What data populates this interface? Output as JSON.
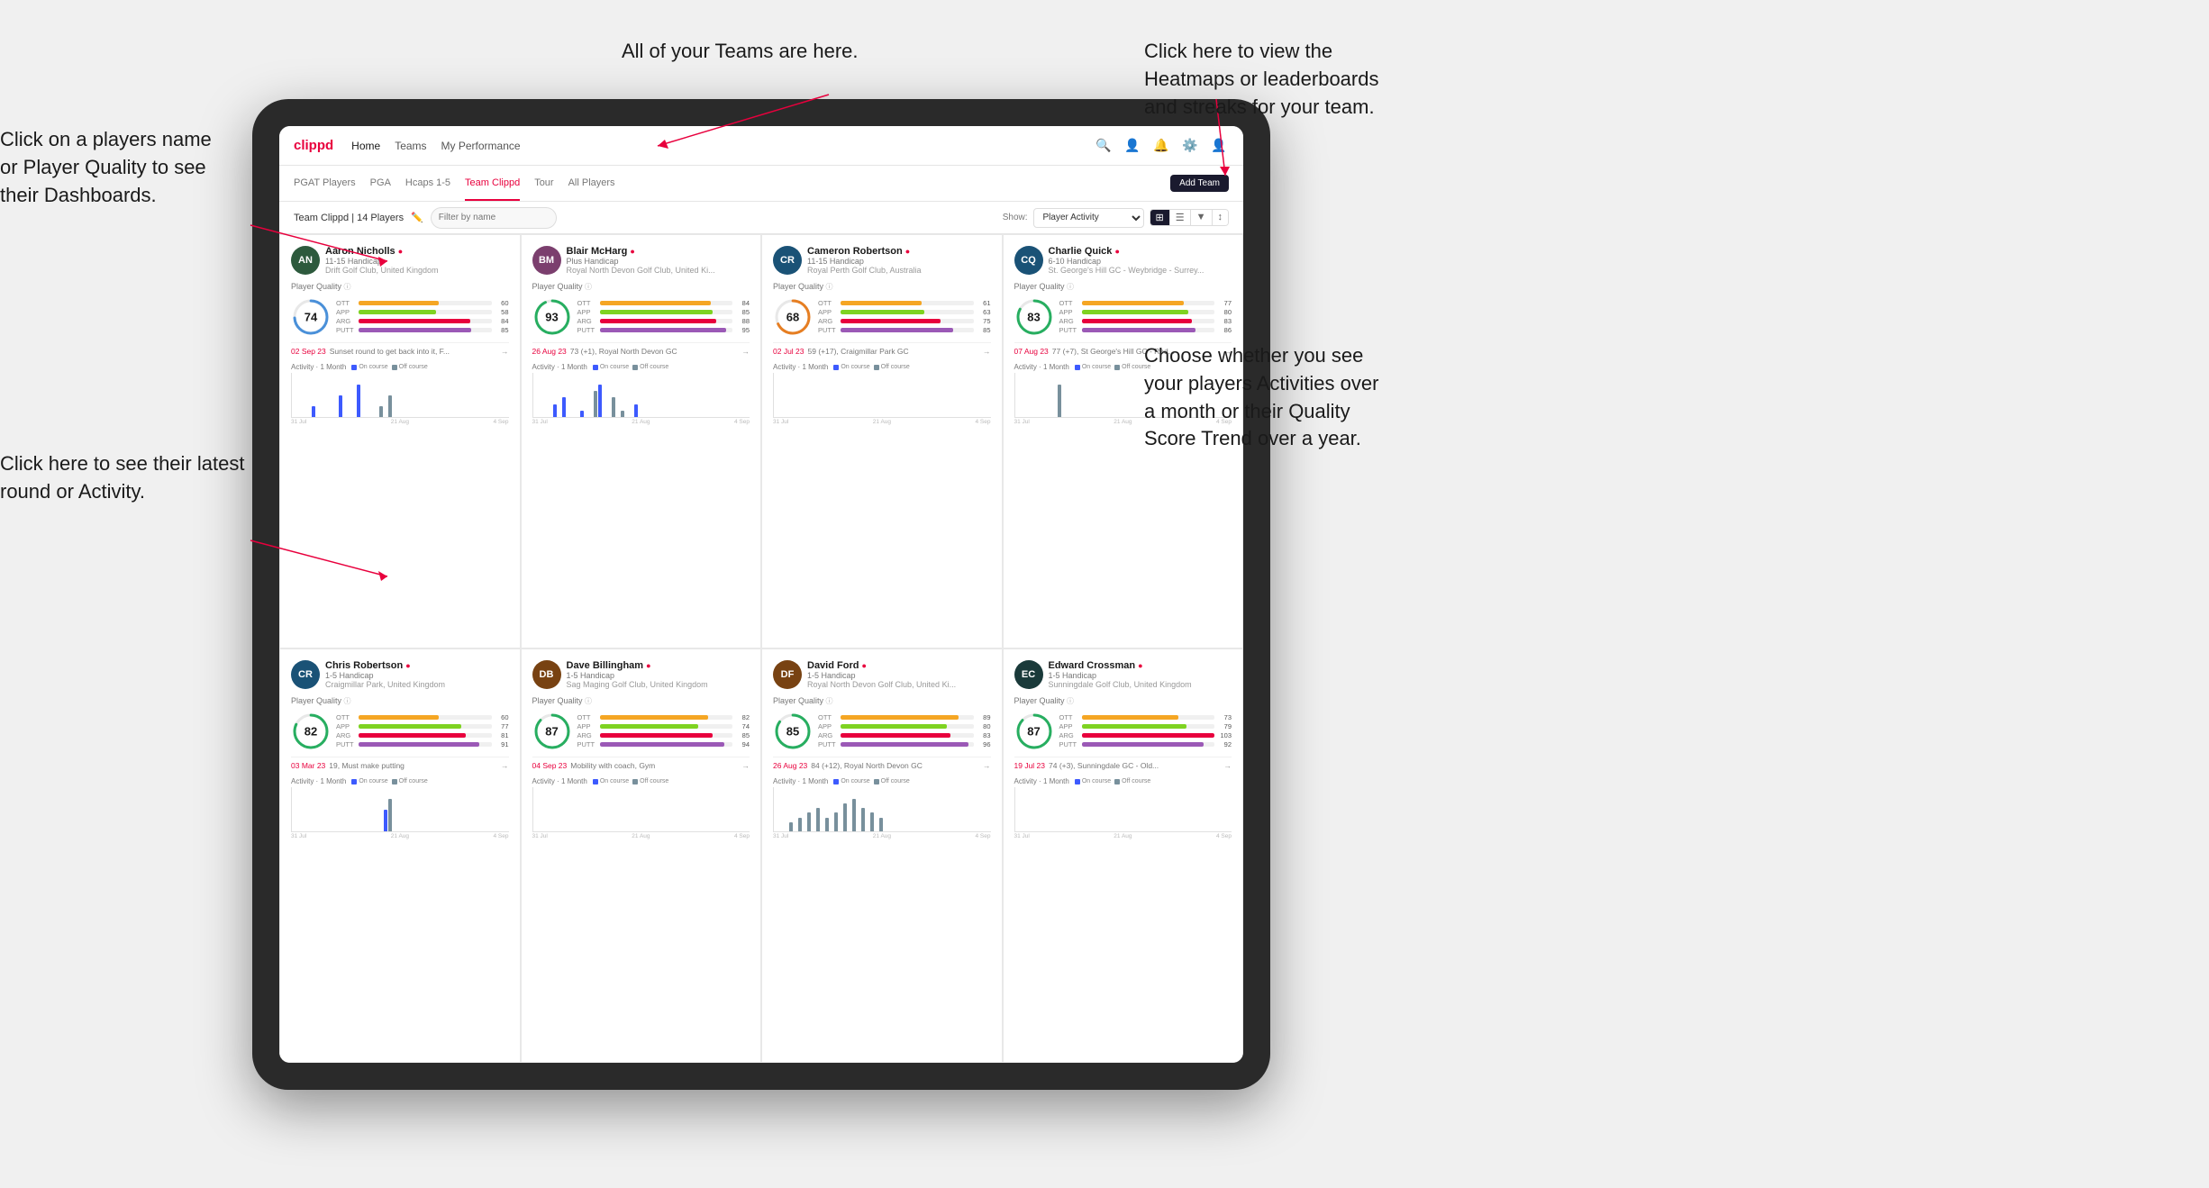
{
  "annotations": {
    "teams_tooltip": "All of your Teams are here.",
    "heatmaps_tooltip": "Click here to view the\nHeatmaps or leaderboards\nand streaks for your team.",
    "players_name_tooltip": "Click on a players name\nor Player Quality to see\ntheir Dashboards.",
    "latest_round_tooltip": "Click here to see their latest\nround or Activity.",
    "activities_tooltip": "Choose whether you see\nyour players Activities over\na month or their Quality\nScore Trend over a year."
  },
  "nav": {
    "logo": "clippd",
    "items": [
      "Home",
      "Teams",
      "My Performance"
    ],
    "active": "Teams"
  },
  "sub_nav": {
    "items": [
      "PGAT Players",
      "PGA",
      "Hcaps 1-5",
      "Team Clippd",
      "Tour",
      "All Players"
    ],
    "active": "Team Clippd",
    "add_team_label": "Add Team"
  },
  "toolbar": {
    "title": "Team Clippd | 14 Players",
    "search_placeholder": "Filter by name",
    "show_label": "Show:",
    "show_options": [
      "Player Activity"
    ],
    "show_selected": "Player Activity"
  },
  "players": [
    {
      "id": "aaron-nicholls",
      "name": "Aaron Nicholls",
      "handicap": "11-15 Handicap",
      "club": "Drift Golf Club, United Kingdom",
      "quality": 74,
      "quality_color": "#4a90d9",
      "ott": 60,
      "app": 58,
      "arg": 84,
      "putt": 85,
      "latest_date": "02 Sep 23",
      "latest_text": "Sunset round to get back into it, F...",
      "chart_data": [
        0,
        0,
        0,
        0,
        1,
        0,
        0,
        0,
        0,
        0,
        2,
        0,
        0,
        0,
        3,
        0,
        0,
        0,
        0,
        1,
        0,
        2,
        0,
        0
      ],
      "initials": "AN"
    },
    {
      "id": "blair-mcharg",
      "name": "Blair McHarg",
      "handicap": "Plus Handicap",
      "club": "Royal North Devon Golf Club, United Ki...",
      "quality": 93,
      "quality_color": "#27ae60",
      "ott": 84,
      "app": 85,
      "arg": 88,
      "putt": 95,
      "latest_date": "26 Aug 23",
      "latest_text": "73 (+1), Royal North Devon GC",
      "chart_data": [
        0,
        0,
        0,
        0,
        2,
        0,
        3,
        0,
        0,
        0,
        1,
        0,
        0,
        4,
        5,
        0,
        0,
        3,
        0,
        1,
        0,
        0,
        2,
        0
      ],
      "initials": "BM"
    },
    {
      "id": "cameron-robertson",
      "name": "Cameron Robertson",
      "handicap": "11-15 Handicap",
      "club": "Royal Perth Golf Club, Australia",
      "quality": 68,
      "quality_color": "#e67e22",
      "ott": 61,
      "app": 63,
      "arg": 75,
      "putt": 85,
      "latest_date": "02 Jul 23",
      "latest_text": "59 (+17), Craigmillar Park GC",
      "chart_data": [
        0,
        0,
        0,
        0,
        0,
        0,
        0,
        0,
        0,
        0,
        0,
        0,
        0,
        0,
        0,
        0,
        0,
        0,
        0,
        0,
        0,
        0,
        0,
        0
      ],
      "initials": "CR"
    },
    {
      "id": "charlie-quick",
      "name": "Charlie Quick",
      "handicap": "6-10 Handicap",
      "club": "St. George's Hill GC - Weybridge - Surrey...",
      "quality": 83,
      "quality_color": "#27ae60",
      "ott": 77,
      "app": 80,
      "arg": 83,
      "putt": 86,
      "latest_date": "07 Aug 23",
      "latest_text": "77 (+7), St George's Hill GC - Red...",
      "chart_data": [
        0,
        0,
        0,
        0,
        0,
        0,
        0,
        0,
        0,
        2,
        0,
        0,
        0,
        0,
        0,
        0,
        0,
        0,
        0,
        0,
        0,
        0,
        0,
        0
      ],
      "initials": "CQ"
    },
    {
      "id": "chris-robertson",
      "name": "Chris Robertson",
      "handicap": "1-5 Handicap",
      "club": "Craigmillar Park, United Kingdom",
      "quality": 82,
      "quality_color": "#27ae60",
      "ott": 60,
      "app": 77,
      "arg": 81,
      "putt": 91,
      "latest_date": "03 Mar 23",
      "latest_text": "19, Must make putting",
      "chart_data": [
        0,
        0,
        0,
        0,
        0,
        0,
        0,
        0,
        0,
        0,
        0,
        0,
        0,
        0,
        0,
        0,
        0,
        0,
        0,
        0,
        2,
        3,
        0,
        0
      ],
      "initials": "CR2"
    },
    {
      "id": "dave-billingham",
      "name": "Dave Billingham",
      "handicap": "1-5 Handicap",
      "club": "Sag Maging Golf Club, United Kingdom",
      "quality": 87,
      "quality_color": "#27ae60",
      "ott": 82,
      "app": 74,
      "arg": 85,
      "putt": 94,
      "latest_date": "04 Sep 23",
      "latest_text": "Mobility with coach, Gym",
      "chart_data": [
        0,
        0,
        0,
        0,
        0,
        0,
        0,
        0,
        0,
        0,
        0,
        0,
        0,
        0,
        0,
        0,
        0,
        0,
        0,
        0,
        0,
        0,
        0,
        0
      ],
      "initials": "DB"
    },
    {
      "id": "david-ford",
      "name": "David Ford",
      "handicap": "1-5 Handicap",
      "club": "Royal North Devon Golf Club, United Ki...",
      "quality": 85,
      "quality_color": "#27ae60",
      "ott": 89,
      "app": 80,
      "arg": 83,
      "putt": 96,
      "latest_date": "26 Aug 23",
      "latest_text": "84 (+12), Royal North Devon GC",
      "chart_data": [
        0,
        0,
        0,
        2,
        0,
        3,
        0,
        4,
        0,
        5,
        0,
        3,
        0,
        4,
        0,
        6,
        0,
        7,
        0,
        5,
        0,
        4,
        0,
        3
      ],
      "initials": "DF"
    },
    {
      "id": "edward-crossman",
      "name": "Edward Crossman",
      "handicap": "1-5 Handicap",
      "club": "Sunningdale Golf Club, United Kingdom",
      "quality": 87,
      "quality_color": "#27ae60",
      "ott": 73,
      "app": 79,
      "arg": 103,
      "putt": 92,
      "latest_date": "19 Jul 23",
      "latest_text": "74 (+3), Sunningdale GC - Old...",
      "chart_data": [
        0,
        0,
        0,
        0,
        0,
        0,
        0,
        0,
        0,
        0,
        0,
        0,
        0,
        0,
        0,
        0,
        0,
        0,
        0,
        0,
        0,
        0,
        0,
        0
      ],
      "initials": "EC"
    }
  ],
  "colors": {
    "brand_red": "#e8003d",
    "nav_dark": "#1a1a2e",
    "bar_ott": "#f5a623",
    "bar_app": "#7ed321",
    "bar_arg": "#e8003d",
    "bar_putt": "#9b59b6",
    "oncourse": "#3d5afe",
    "offcourse": "#78909c"
  }
}
